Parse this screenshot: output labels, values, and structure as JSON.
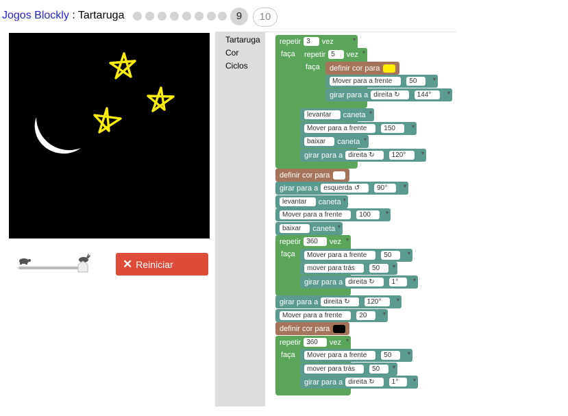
{
  "header": {
    "app_link": "Jogos Blockly",
    "separator": " : ",
    "game": "Tartaruga",
    "current_level": "9",
    "next_level": "10"
  },
  "controls": {
    "reset_label": "Reiniciar"
  },
  "toolbox": {
    "categories": [
      "Tartaruga",
      "Cor",
      "Ciclos"
    ]
  },
  "colors": {
    "loop": "#5ba55b",
    "turtle": "#5b9a8e",
    "color": "#a5745b",
    "reset": "#dd4b39",
    "yellow": "#ffee00",
    "white": "#ffffff",
    "black": "#000000"
  },
  "blocks": {
    "repeat": "repetir",
    "times": "vez",
    "do": "faça",
    "set_color": "definir cor para",
    "forward_sel": "Mover para a frente",
    "back_sel": "mover para trás",
    "turn": "girar para a",
    "right": "direita ↻",
    "left": "esquerda ↺",
    "pen_up": "levantar",
    "pen_down": "baixar",
    "pen": "caneta",
    "outer_repeat": "3",
    "inner_repeat": "5",
    "move_50": "50",
    "turn_144": "144°",
    "move_150": "150",
    "turn_120": "120°",
    "turn_90": "90°",
    "move_100": "100",
    "repeat_360": "360",
    "turn_1": "1°",
    "move_20": "20"
  }
}
